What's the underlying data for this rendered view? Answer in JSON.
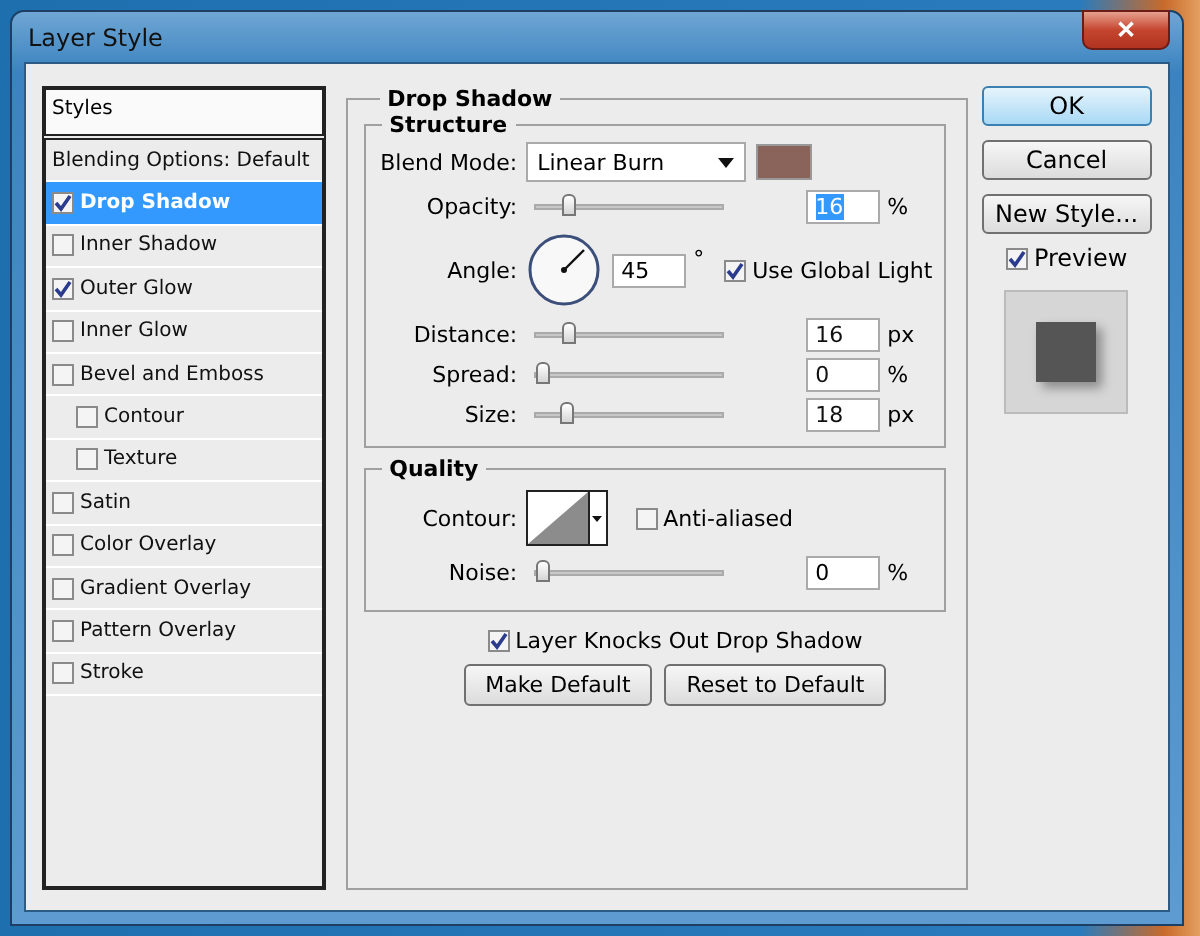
{
  "window": {
    "title": "Layer Style",
    "close": "✕"
  },
  "styles_panel": {
    "header": "Styles",
    "items": [
      {
        "label": "Blending Options: Default",
        "kind": "plain",
        "selected": false
      },
      {
        "label": "Drop Shadow",
        "kind": "checkbox",
        "checked": true,
        "selected": true
      },
      {
        "label": "Inner Shadow",
        "kind": "checkbox",
        "checked": false,
        "selected": false
      },
      {
        "label": "Outer Glow",
        "kind": "checkbox",
        "checked": true,
        "selected": false
      },
      {
        "label": "Inner Glow",
        "kind": "checkbox",
        "checked": false,
        "selected": false
      },
      {
        "label": "Bevel and Emboss",
        "kind": "checkbox",
        "checked": false,
        "selected": false,
        "children": [
          {
            "label": "Contour",
            "kind": "checkbox",
            "checked": false,
            "selected": false
          },
          {
            "label": "Texture",
            "kind": "checkbox",
            "checked": false,
            "selected": false
          }
        ]
      },
      {
        "label": "Satin",
        "kind": "checkbox",
        "checked": false,
        "selected": false
      },
      {
        "label": "Color Overlay",
        "kind": "checkbox",
        "checked": false,
        "selected": false
      },
      {
        "label": "Gradient Overlay",
        "kind": "checkbox",
        "checked": false,
        "selected": false
      },
      {
        "label": "Pattern Overlay",
        "kind": "checkbox",
        "checked": false,
        "selected": false
      },
      {
        "label": "Stroke",
        "kind": "checkbox",
        "checked": false,
        "selected": false
      }
    ]
  },
  "drop_shadow": {
    "title": "Drop Shadow",
    "structure": {
      "title": "Structure",
      "rows": [
        {
          "kind": "select",
          "label": "Blend Mode:",
          "value": "Linear Burn",
          "color": "#8a645b"
        },
        {
          "kind": "slider",
          "label": "Opacity:",
          "level": 0.16,
          "value": "16",
          "unit": "%",
          "text_selected": true
        },
        {
          "kind": "angle",
          "label": "Angle:",
          "value": "45",
          "unit": "°",
          "check_label": "Use Global Light",
          "checked": true
        },
        {
          "kind": "slider",
          "label": "Distance:",
          "level": 0.16,
          "value": "16",
          "unit": "px",
          "text_selected": false
        },
        {
          "kind": "slider",
          "label": "Spread:",
          "level": 0,
          "value": "0",
          "unit": "%",
          "text_selected": false
        },
        {
          "kind": "slider",
          "label": "Size:",
          "level": 0.14,
          "value": "18",
          "unit": "px",
          "text_selected": false
        }
      ]
    },
    "quality": {
      "title": "Quality",
      "contour_label": "Contour:",
      "anti_aliased": {
        "label": "Anti-aliased",
        "checked": false
      },
      "noise": {
        "label": "Noise:",
        "level": 0,
        "value": "0",
        "unit": "%"
      }
    },
    "knockout": {
      "label": "Layer Knocks Out Drop Shadow",
      "checked": true
    },
    "buttons": [
      "Make Default",
      "Reset to Default"
    ]
  },
  "actions": [
    {
      "label": "OK",
      "default": true
    },
    {
      "label": "Cancel",
      "default": false
    },
    {
      "label": "New Style...",
      "default": false
    }
  ],
  "preview": {
    "label": "Preview",
    "checked": true
  }
}
